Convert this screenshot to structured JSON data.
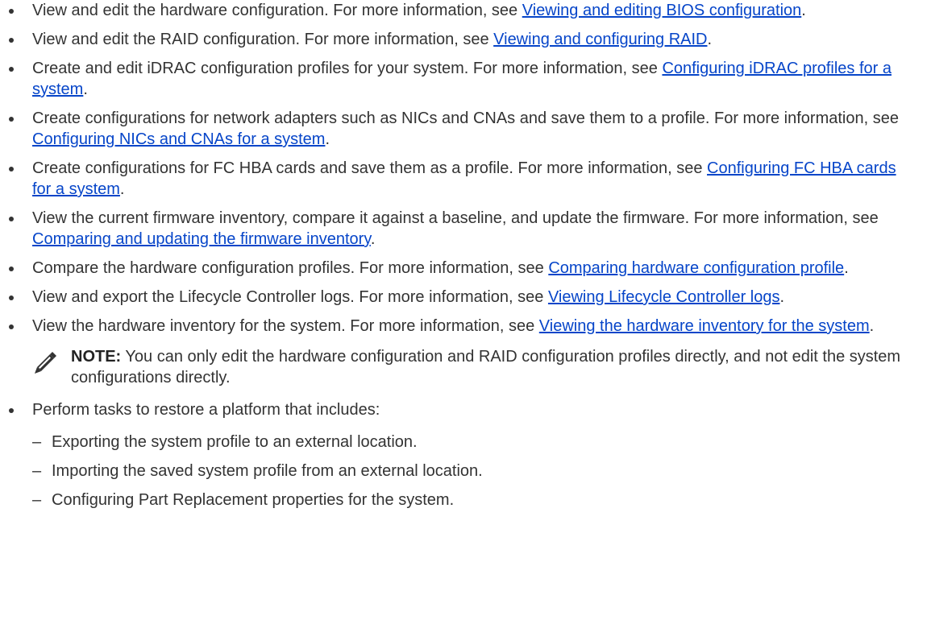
{
  "colors": {
    "text": "#333333",
    "link": "#0645c9",
    "bullet": "#333333"
  },
  "bullets": [
    {
      "text": "View and edit the hardware configuration. For more information, see ",
      "link": "Viewing and editing BIOS configuration",
      "end": "."
    },
    {
      "text": "View and edit the RAID configuration. For more information, see ",
      "link": "Viewing and configuring RAID",
      "end": "."
    },
    {
      "text": "Create and edit iDRAC configuration profiles for your system. For more information, see ",
      "link": "Configuring iDRAC profiles for a system",
      "end": "."
    },
    {
      "text": "Create configurations for network adapters such as NICs and CNAs and save them to a profile. For more information, see ",
      "link": "Configuring NICs and CNAs for a system",
      "end": "."
    },
    {
      "text": "Create configurations for FC HBA cards and save them as a profile. For more information, see ",
      "link": "Configuring FC HBA cards for a system",
      "end": "."
    },
    {
      "text": "View the current firmware inventory, compare it against a baseline, and update the firmware. For more information, see ",
      "link": "Comparing and updating the firmware inventory",
      "end": "."
    },
    {
      "text": "Compare the hardware configuration profiles. For more information, see ",
      "link": "Comparing hardware configuration profile",
      "end": "."
    },
    {
      "text": "View and export the Lifecycle Controller logs. For more information, see ",
      "link": "Viewing Lifecycle Controller logs",
      "end": "."
    },
    {
      "text": "View the hardware inventory for the system. For more information, see ",
      "link": "Viewing the hardware inventory for the system",
      "end": "."
    }
  ],
  "note": {
    "icon": "pencil-note-icon",
    "label": "NOTE:",
    "text": " You can only edit the hardware configuration and RAID configuration profiles directly, and not edit the system configurations directly."
  },
  "last_bullet": {
    "text": "Perform tasks to restore a platform that includes:",
    "subitems": [
      {
        "dash": "–",
        "text": "Exporting the system profile to an external location."
      },
      {
        "dash": "–",
        "text": "Importing the saved system profile from an external location."
      },
      {
        "dash": "–",
        "text": "Configuring Part Replacement properties for the system."
      }
    ]
  }
}
